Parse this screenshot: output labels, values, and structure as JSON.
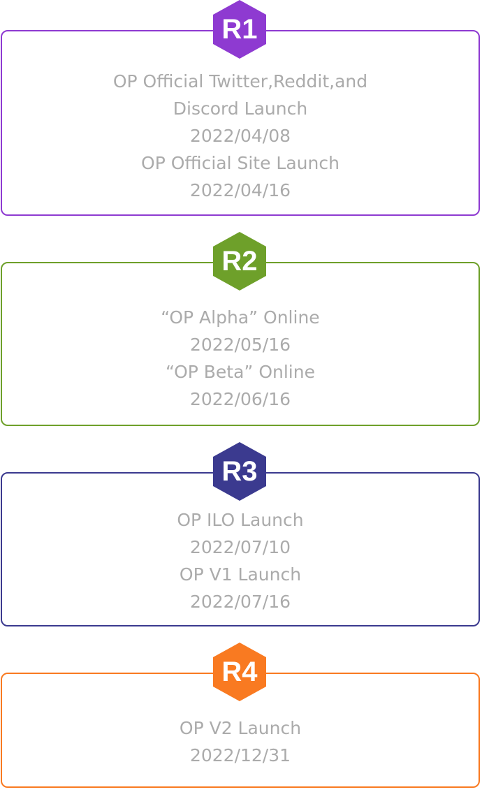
{
  "colors": {
    "r1": "#8e3ad1",
    "r2": "#6ea02a",
    "r3": "#3b3a8f",
    "r4": "#f97a21",
    "text": "#ababab"
  },
  "rounds": [
    {
      "badge": "R1",
      "lines": [
        "OP Official Twitter,Reddit,and",
        "Discord Launch",
        "2022/04/08",
        "OP Official Site Launch",
        "2022/04/16"
      ]
    },
    {
      "badge": "R2",
      "lines": [
        "“OP Alpha”  Online",
        "2022/05/16",
        "“OP Beta”  Online",
        "2022/06/16"
      ]
    },
    {
      "badge": "R3",
      "lines": [
        "OP ILO Launch",
        "2022/07/10",
        "OP V1 Launch",
        "2022/07/16"
      ]
    },
    {
      "badge": "R4",
      "lines": [
        "OP V2 Launch",
        "2022/12/31"
      ]
    }
  ]
}
